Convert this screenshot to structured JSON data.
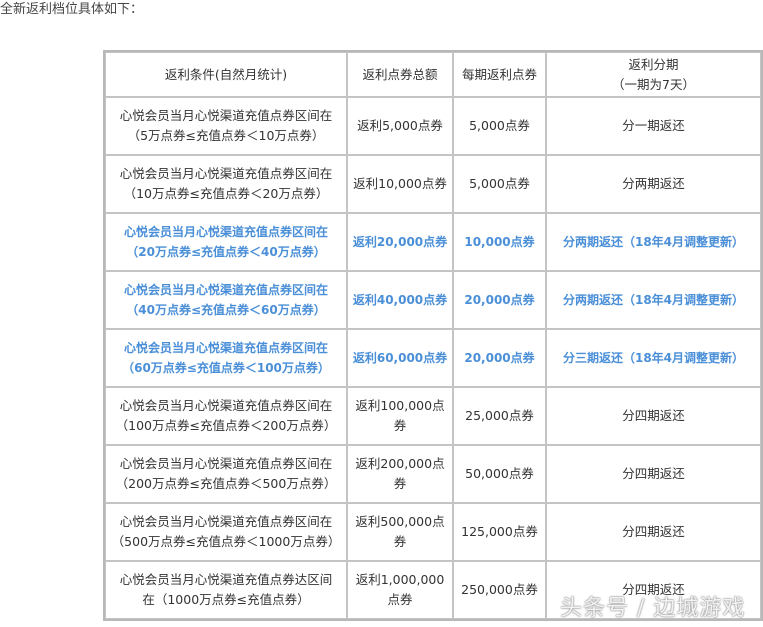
{
  "intro": "全新返利档位具体如下：",
  "headers": {
    "condition": "返利条件(自然月统计)",
    "total": "返利点券总额",
    "per_period": "每期返利点券",
    "installment_line1": "返利分期",
    "installment_line2": "（一期为7天）"
  },
  "rows": [
    {
      "cond1": "心悦会员当月心悦渠道充值点券区间在",
      "cond2": "（5万点券≤充值点券＜10万点券）",
      "total": "返利5,000点券",
      "per": "5,000点券",
      "inst": "分一期返还",
      "highlight": false
    },
    {
      "cond1": "心悦会员当月心悦渠道充值点券区间在",
      "cond2": "（10万点券≤充值点券＜20万点券）",
      "total": "返利10,000点券",
      "per": "5,000点券",
      "inst": "分两期返还",
      "highlight": false
    },
    {
      "cond1": "心悦会员当月心悦渠道充值点券区间在",
      "cond2": "（20万点券≤充值点券＜40万点券）",
      "total": "返利20,000点券",
      "per": "10,000点券",
      "inst": "分两期返还（18年4月调整更新）",
      "highlight": true
    },
    {
      "cond1": "心悦会员当月心悦渠道充值点券区间在",
      "cond2": "（40万点券≤充值点券＜60万点券）",
      "total": "返利40,000点券",
      "per": "20,000点券",
      "inst": "分两期返还（18年4月调整更新）",
      "highlight": true
    },
    {
      "cond1": "心悦会员当月心悦渠道充值点券区间在",
      "cond2": "（60万点券≤充值点券＜100万点券）",
      "total": "返利60,000点券",
      "per": "20,000点券",
      "inst": "分三期返还（18年4月调整更新）",
      "highlight": true
    },
    {
      "cond1": "心悦会员当月心悦渠道充值点券区间在",
      "cond2": "（100万点券≤充值点券＜200万点券）",
      "total": "返利100,000点券",
      "per": "25,000点券",
      "inst": "分四期返还",
      "highlight": false
    },
    {
      "cond1": "心悦会员当月心悦渠道充值点券区间在",
      "cond2": "（200万点券≤充值点券＜500万点券）",
      "total": "返利200,000点券",
      "per": "50,000点券",
      "inst": "分四期返还",
      "highlight": false
    },
    {
      "cond1": "心悦会员当月心悦渠道充值点券区间在",
      "cond2": "（500万点券≤充值点券＜1000万点券）",
      "total": "返利500,000点券",
      "per": "125,000点券",
      "inst": "分四期返还",
      "highlight": false
    },
    {
      "cond1": "心悦会员当月心悦渠道充值点券达区间",
      "cond2": "在（1000万点券≤充值点券）",
      "total": "返利1,000,000点券",
      "per": "250,000点券",
      "inst": "分四期返还",
      "highlight": false
    }
  ],
  "watermark": "头条号 / 边城游戏",
  "colors": {
    "highlight": "#4a8fd8",
    "border": "#c4c4c4"
  }
}
